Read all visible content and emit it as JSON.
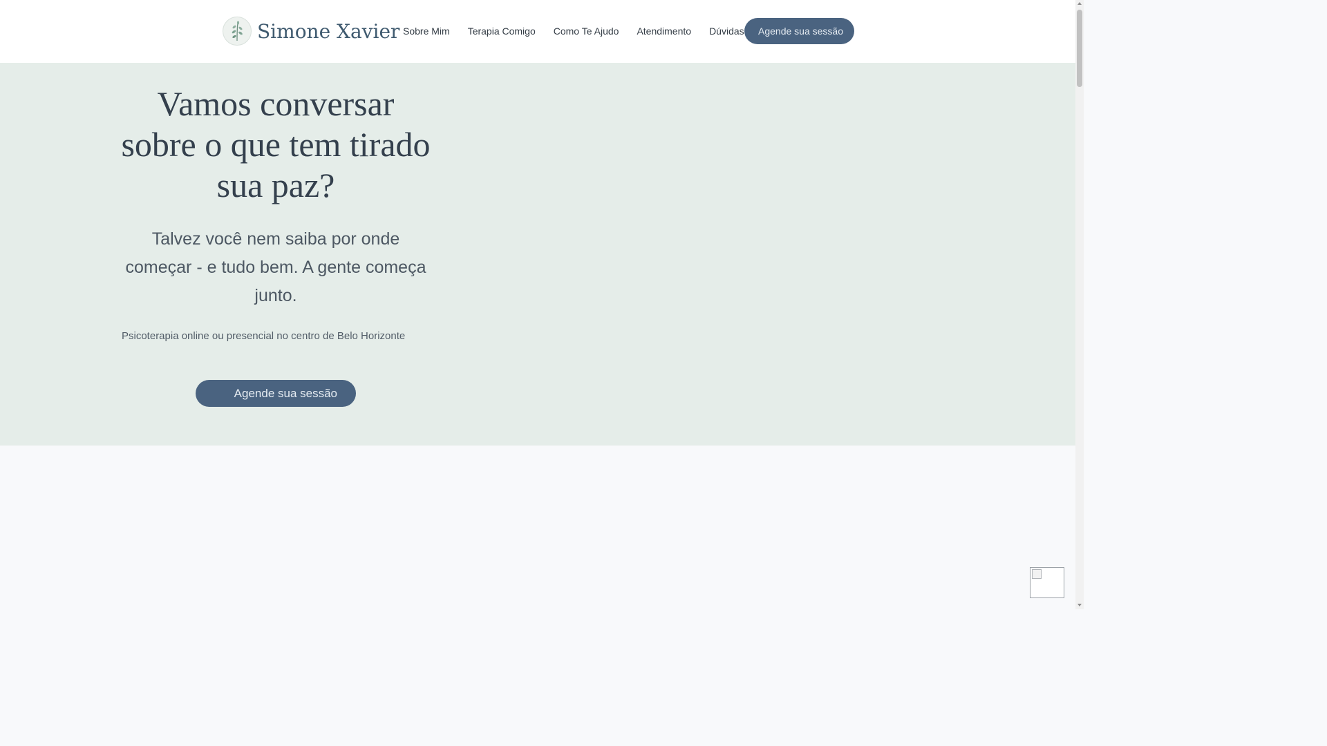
{
  "header": {
    "logo_text": "Simone Xavier",
    "nav": [
      {
        "label": "Sobre Mim"
      },
      {
        "label": "Terapia Comigo"
      },
      {
        "label": "Como Te Ajudo"
      },
      {
        "label": "Atendimento"
      },
      {
        "label": "Dúvidas"
      }
    ],
    "cta_label": "Agende sua sessão"
  },
  "hero": {
    "title": "Vamos conversar sobre o que tem tirado sua paz?",
    "subtitle": "Talvez você nem saiba por onde começar - e tudo bem. A gente começa junto.",
    "note": "Psicoterapia online ou presencial no centro de Belo Horizonte",
    "cta_label": "Agende sua sessão"
  },
  "colors": {
    "header_bg": "#ffffff",
    "hero_bg": "#e5ede9",
    "button": "#4a6380",
    "logo_text": "#3f5a6f"
  },
  "icons": {
    "logo": "leaf-sprig-icon",
    "broken_image": "broken-image-icon"
  }
}
